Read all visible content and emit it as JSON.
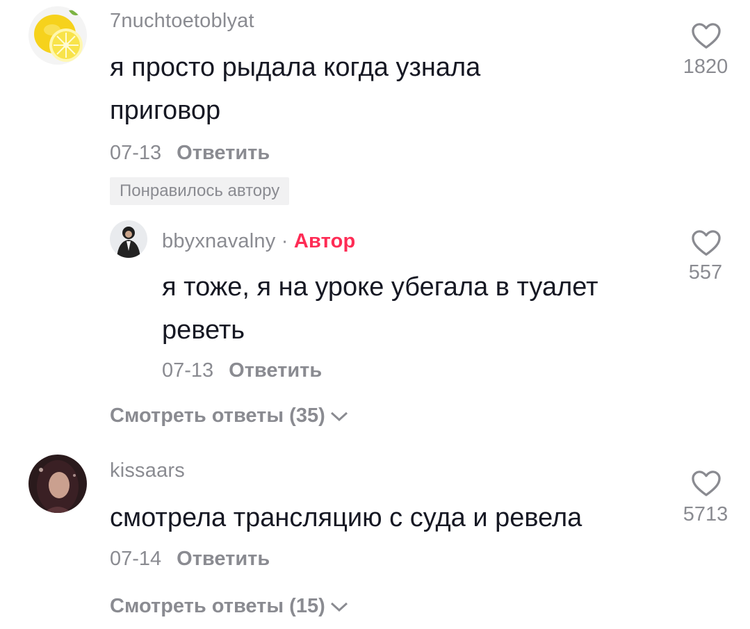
{
  "comments": [
    {
      "username": "7nuchtoetoblyat",
      "text": "я просто рыдала когда узнала приговор",
      "date": "07-13",
      "reply_label": "Ответить",
      "liked_by_author_label": "Понравилось автору",
      "likes": "1820",
      "avatar_icon": "lemon-avatar-icon",
      "reply": {
        "username": "bbyxnavalny",
        "separator": "·",
        "author_label": "Автор",
        "text": "я тоже, я на уроке убегала в туалет реветь",
        "date": "07-13",
        "reply_label": "Ответить",
        "likes": "557"
      },
      "view_replies_label": "Смотреть ответы (35)"
    },
    {
      "username": "kissaars",
      "text": "смотрела трансляцию с суда и ревела",
      "date": "07-14",
      "reply_label": "Ответить",
      "likes": "5713",
      "view_replies_label": "Смотреть ответы (15)"
    }
  ],
  "colors": {
    "text": "#161823",
    "muted": "#8a8b91",
    "author_accent": "#fe2c55",
    "badge_bg": "#f1f1f2"
  }
}
